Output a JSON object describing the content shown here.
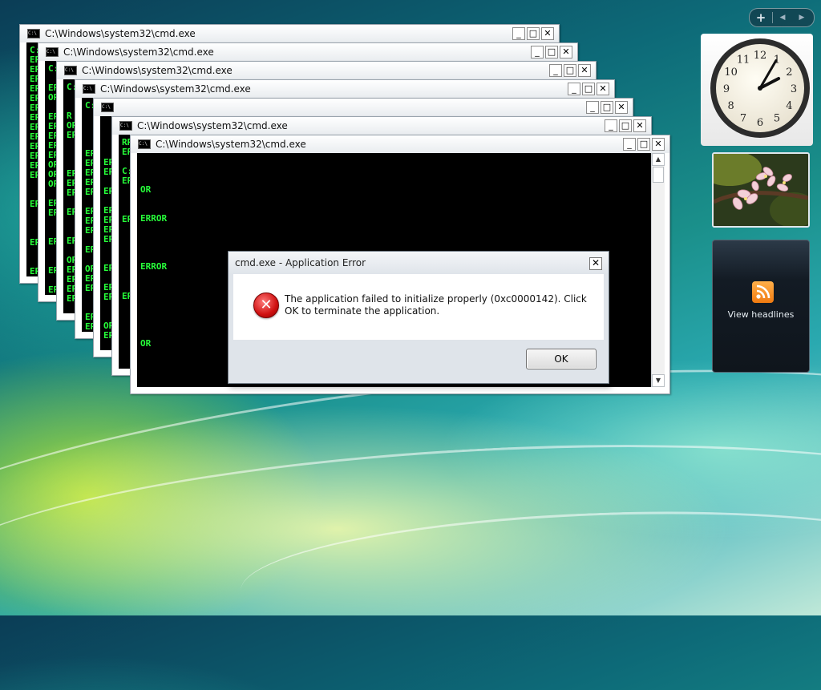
{
  "sidebar": {
    "add_symbol": "+",
    "prev_symbol": "◀",
    "next_symbol": "▶"
  },
  "console_windows": [
    {
      "title": "C:\\Windows\\system32\\cmd.exe",
      "lines": "C:\nER\nER\nER\nER\nER\nER\nER\nER\nER\nER\nER\nER\nER\n\n\nER\n\n\n\nER\n\n\nER"
    },
    {
      "title": "C:\\Windows\\system32\\cmd.exe",
      "lines": "C:\n\nER\nOR\n\nER\nER\nER\nER\nER\nOR\nOR\nOR\n\nER\nER\n\n\nER\n\n\nER\n\nER\nER\n\nER\nER"
    },
    {
      "title": "C:\\Windows\\system32\\cmd.exe",
      "lines": "C:\n\n\nR\nOR\nER\n\n\n\nER\nER\nER\n\nER\n\n\nER\n\nOR\nER\nER\nER\nER\n\nER\nOR\nER\nER"
    },
    {
      "title": "C:\\Windows\\system32\\cmd.exe",
      "lines": "C:\n\n\n\n\nER\nER\nER\nER\nER\n\nER\nER\nER\n\nER\n\nOR\nER\nER\n\n\nER\nER\nOR\nER"
    },
    {
      "title": "",
      "lines": "\n\n\n\nER\nER\n\nER\n\nER\nER\nER\nER\n\n\nER\n\nER\nER\n\n\nOR\nER"
    },
    {
      "title": "C:\\Windows\\system32\\cmd.exe",
      "lines": "RR\nER\n\nC:\nER\n\n\n\nER\n\n\n\n\n\n\n\nER\n\n\n\n\n\n\n\n\nOR\nER\n\n\nOR"
    },
    {
      "title": "C:\\Windows\\system32\\cmd.exe",
      "lines": "\n\n\nOR\n\n\nERROR\n\n\n\n\nERROR\n\n\n\n\n\n\n\nOR"
    }
  ],
  "window_buttons": {
    "minimize": "_",
    "maximize": "□",
    "close": "✕"
  },
  "dialog": {
    "title": "cmd.exe - Application Error",
    "message": "The application failed to initialize properly (0xc0000142). Click OK to terminate the application.",
    "ok_label": "OK",
    "close_symbol": "✕",
    "icon_symbol": "✕"
  },
  "clock": {
    "numerals": [
      "12",
      "1",
      "2",
      "3",
      "4",
      "5",
      "6",
      "7",
      "8",
      "9",
      "10",
      "11"
    ],
    "time": "2:05"
  },
  "feed": {
    "headlines_label": "View headlines"
  },
  "colors": {
    "console_text": "#27ff3a",
    "error_red": "#d01010",
    "rss_orange": "#f07a10"
  },
  "icons": [
    "cmd-icon",
    "error-icon",
    "rss-icon",
    "clock-gadget",
    "photo-gadget"
  ]
}
